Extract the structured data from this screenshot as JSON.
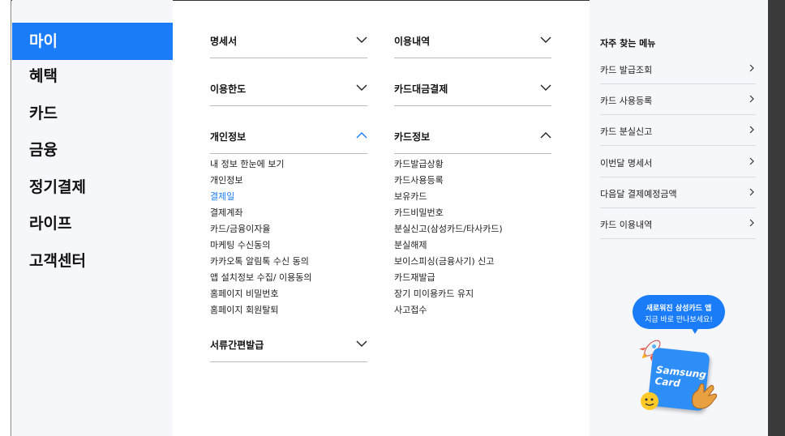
{
  "sidebar": {
    "items": [
      {
        "label": "마이",
        "active": true
      },
      {
        "label": "혜택"
      },
      {
        "label": "카드"
      },
      {
        "label": "금융"
      },
      {
        "label": "정기결제"
      },
      {
        "label": "라이프"
      },
      {
        "label": "고객센터"
      }
    ]
  },
  "menu": {
    "left": [
      {
        "title": "명세서",
        "expanded": false
      },
      {
        "title": "이용한도",
        "expanded": false
      },
      {
        "title": "개인정보",
        "expanded": true,
        "items": [
          "내 정보 한눈에 보기",
          "개인정보",
          "결제일",
          "결제계좌",
          "카드/금융이자율",
          "마케팅 수신동의",
          "카카오톡 알림톡 수신 동의",
          "앱 설치정보 수집/ 이용동의",
          "홈페이지 비밀번호",
          "홈페이지 회원탈퇴"
        ],
        "highlighted_index": 2
      },
      {
        "title": "서류간편발급",
        "expanded": false
      }
    ],
    "right": [
      {
        "title": "이용내역",
        "expanded": false
      },
      {
        "title": "카드대금결제",
        "expanded": false
      },
      {
        "title": "카드정보",
        "expanded": true,
        "items": [
          "카드발급상황",
          "카드사용등록",
          "보유카드",
          "카드비밀번호",
          "분실신고(삼성카드/타사카드)",
          "분실해제",
          "보이스피싱(금융사기) 신고",
          "카드재발급",
          "장기 미이용카드 유지",
          "사고접수"
        ]
      }
    ]
  },
  "favorites": {
    "title": "자주 찾는 메뉴",
    "items": [
      "카드 발급조회",
      "카드 사용등록",
      "카드 분실신고",
      "이번달 명세서",
      "다음달 결제예정금액",
      "카드 이용내역"
    ]
  },
  "promo": {
    "line1": "새로워진 삼성카드 앱",
    "line2": "지금 바로 만나보세요!",
    "card_line1": "Samsung",
    "card_line2": "Card"
  },
  "colors": {
    "accent": "#1a7cf8",
    "sidebar_bg": "#f6f7fb"
  }
}
